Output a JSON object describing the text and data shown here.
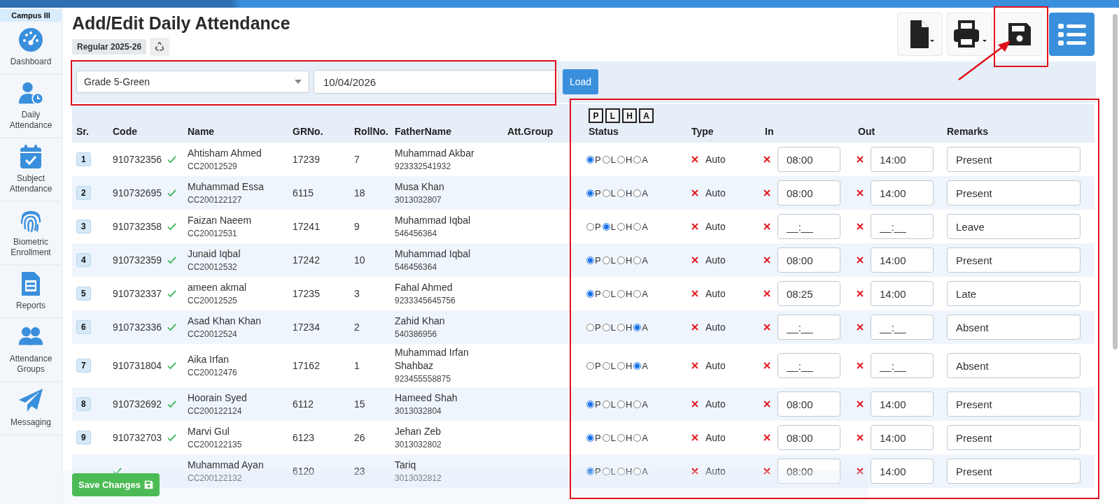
{
  "sidebar": {
    "campus": "Campus III",
    "items": [
      {
        "label": "Dashboard"
      },
      {
        "label": "Daily Attendance"
      },
      {
        "label": "Subject Attendance"
      },
      {
        "label": "Biometric Enrollment"
      },
      {
        "label": "Reports"
      },
      {
        "label": "Attendance Groups"
      },
      {
        "label": "Messaging"
      }
    ]
  },
  "page": {
    "title": "Add/Edit Daily Attendance",
    "session": "Regular 2025-26"
  },
  "filters": {
    "class": "Grade 5-Green",
    "date": "10/04/2026",
    "load": "Load"
  },
  "table": {
    "status_buttons": [
      "P",
      "L",
      "H",
      "A"
    ],
    "columns": [
      "Sr.",
      "Code",
      "Name",
      "GRNo.",
      "RollNo.",
      "FatherName",
      "Att.Group",
      "Status",
      "Type",
      "In",
      "Out",
      "Remarks"
    ],
    "rows": [
      {
        "sr": "1",
        "code": "910732356",
        "verified": true,
        "name": "Ahtisham Ahmed",
        "id": "CC20012529",
        "gr": "17239",
        "roll": "7",
        "father": "Muhammad Akbar",
        "phone": "923332541932",
        "status": [
          {
            "label": "P",
            "selected": true
          },
          {
            "label": "L",
            "selected": false
          },
          {
            "label": "H",
            "selected": false
          },
          {
            "label": "A",
            "selected": false
          }
        ],
        "type": "Auto",
        "in": {
          "value": "08:00"
        },
        "out": {
          "value": "14:00"
        },
        "remarks": "Present"
      },
      {
        "sr": "2",
        "code": "910732695",
        "verified": true,
        "name": "Muhammad Essa",
        "id": "CC200122127",
        "gr": "6115",
        "roll": "18",
        "father": "Musa Khan",
        "phone": "3013032807",
        "status": [
          {
            "label": "P",
            "selected": true
          },
          {
            "label": "L",
            "selected": false
          },
          {
            "label": "H",
            "selected": false
          },
          {
            "label": "A",
            "selected": false
          }
        ],
        "type": "Auto",
        "in": {
          "value": "08:00"
        },
        "out": {
          "value": "14:00"
        },
        "remarks": "Present"
      },
      {
        "sr": "3",
        "code": "910732358",
        "verified": true,
        "name": "Faizan Naeem",
        "id": "CC20012531",
        "gr": "17241",
        "roll": "9",
        "father": "Muhammad Iqbal",
        "phone": "546456364",
        "status": [
          {
            "label": "P",
            "selected": false
          },
          {
            "label": "L",
            "selected": true
          },
          {
            "label": "H",
            "selected": false
          },
          {
            "label": "A",
            "selected": false
          }
        ],
        "type": "Auto",
        "in": {
          "placeholder": "__:__"
        },
        "out": {
          "placeholder": "__:__"
        },
        "remarks": "Leave"
      },
      {
        "sr": "4",
        "code": "910732359",
        "verified": true,
        "name": "Junaid Iqbal",
        "id": "CC20012532",
        "gr": "17242",
        "roll": "10",
        "father": "Muhammad Iqbal",
        "phone": "546456364",
        "status": [
          {
            "label": "P",
            "selected": true
          },
          {
            "label": "L",
            "selected": false
          },
          {
            "label": "H",
            "selected": false
          },
          {
            "label": "A",
            "selected": false
          }
        ],
        "type": "Auto",
        "in": {
          "value": "08:00"
        },
        "out": {
          "value": "14:00"
        },
        "remarks": "Present"
      },
      {
        "sr": "5",
        "code": "910732337",
        "verified": true,
        "name": "ameen akmal",
        "id": "CC20012525",
        "gr": "17235",
        "roll": "3",
        "father": "Fahal Ahmed",
        "phone": "9233345645756",
        "status": [
          {
            "label": "P",
            "selected": true
          },
          {
            "label": "L",
            "selected": false
          },
          {
            "label": "H",
            "selected": false
          },
          {
            "label": "A",
            "selected": false
          }
        ],
        "type": "Auto",
        "in": {
          "value": "08:25"
        },
        "out": {
          "value": "14:00"
        },
        "remarks": "Late"
      },
      {
        "sr": "6",
        "code": "910732336",
        "verified": true,
        "name": "Asad Khan Khan",
        "id": "CC20012524",
        "gr": "17234",
        "roll": "2",
        "father": "Zahid Khan",
        "phone": "540386956",
        "status": [
          {
            "label": "P",
            "selected": false
          },
          {
            "label": "L",
            "selected": false
          },
          {
            "label": "H",
            "selected": false
          },
          {
            "label": "A",
            "selected": true
          }
        ],
        "type": "Auto",
        "in": {
          "placeholder": "__:__"
        },
        "out": {
          "placeholder": "__:__"
        },
        "remarks": "Absent"
      },
      {
        "sr": "7",
        "code": "910731804",
        "verified": true,
        "name": "Aika Irfan",
        "id": "CC20012476",
        "gr": "17162",
        "roll": "1",
        "father": "Muhammad Irfan Shahbaz",
        "phone": "923455558875",
        "status": [
          {
            "label": "P",
            "selected": false
          },
          {
            "label": "L",
            "selected": false
          },
          {
            "label": "H",
            "selected": false
          },
          {
            "label": "A",
            "selected": true
          }
        ],
        "type": "Auto",
        "in": {
          "placeholder": "__:__"
        },
        "out": {
          "placeholder": "__:__"
        },
        "remarks": "Absent"
      },
      {
        "sr": "8",
        "code": "910732692",
        "verified": true,
        "name": "Hoorain Syed",
        "id": "CC200122124",
        "gr": "6112",
        "roll": "15",
        "father": "Hameed Shah",
        "phone": "3013032804",
        "status": [
          {
            "label": "P",
            "selected": true
          },
          {
            "label": "L",
            "selected": false
          },
          {
            "label": "H",
            "selected": false
          },
          {
            "label": "A",
            "selected": false
          }
        ],
        "type": "Auto",
        "in": {
          "value": "08:00"
        },
        "out": {
          "value": "14:00"
        },
        "remarks": "Present"
      },
      {
        "sr": "9",
        "code": "910732703",
        "verified": true,
        "name": "Marvi Gul",
        "id": "CC200122135",
        "gr": "6123",
        "roll": "26",
        "father": "Jehan Zeb",
        "phone": "3013032802",
        "status": [
          {
            "label": "P",
            "selected": true
          },
          {
            "label": "L",
            "selected": false
          },
          {
            "label": "H",
            "selected": false
          },
          {
            "label": "A",
            "selected": false
          }
        ],
        "type": "Auto",
        "in": {
          "value": "08:00"
        },
        "out": {
          "value": "14:00"
        },
        "remarks": "Present"
      },
      {
        "verified": true,
        "name": "Muhammad Ayan",
        "id": "CC200122132",
        "gr": "6120",
        "roll": "23",
        "father": "Tariq",
        "phone": "3013032812",
        "status": [
          {
            "label": "P",
            "selected": true
          },
          {
            "label": "L",
            "selected": false
          },
          {
            "label": "H",
            "selected": false
          },
          {
            "label": "A",
            "selected": false
          }
        ],
        "type": "Auto",
        "in": {
          "value": "08:00"
        },
        "out": {
          "value": "14:00"
        },
        "remarks": "Present"
      }
    ]
  },
  "footer": {
    "save": "Save Changes"
  }
}
